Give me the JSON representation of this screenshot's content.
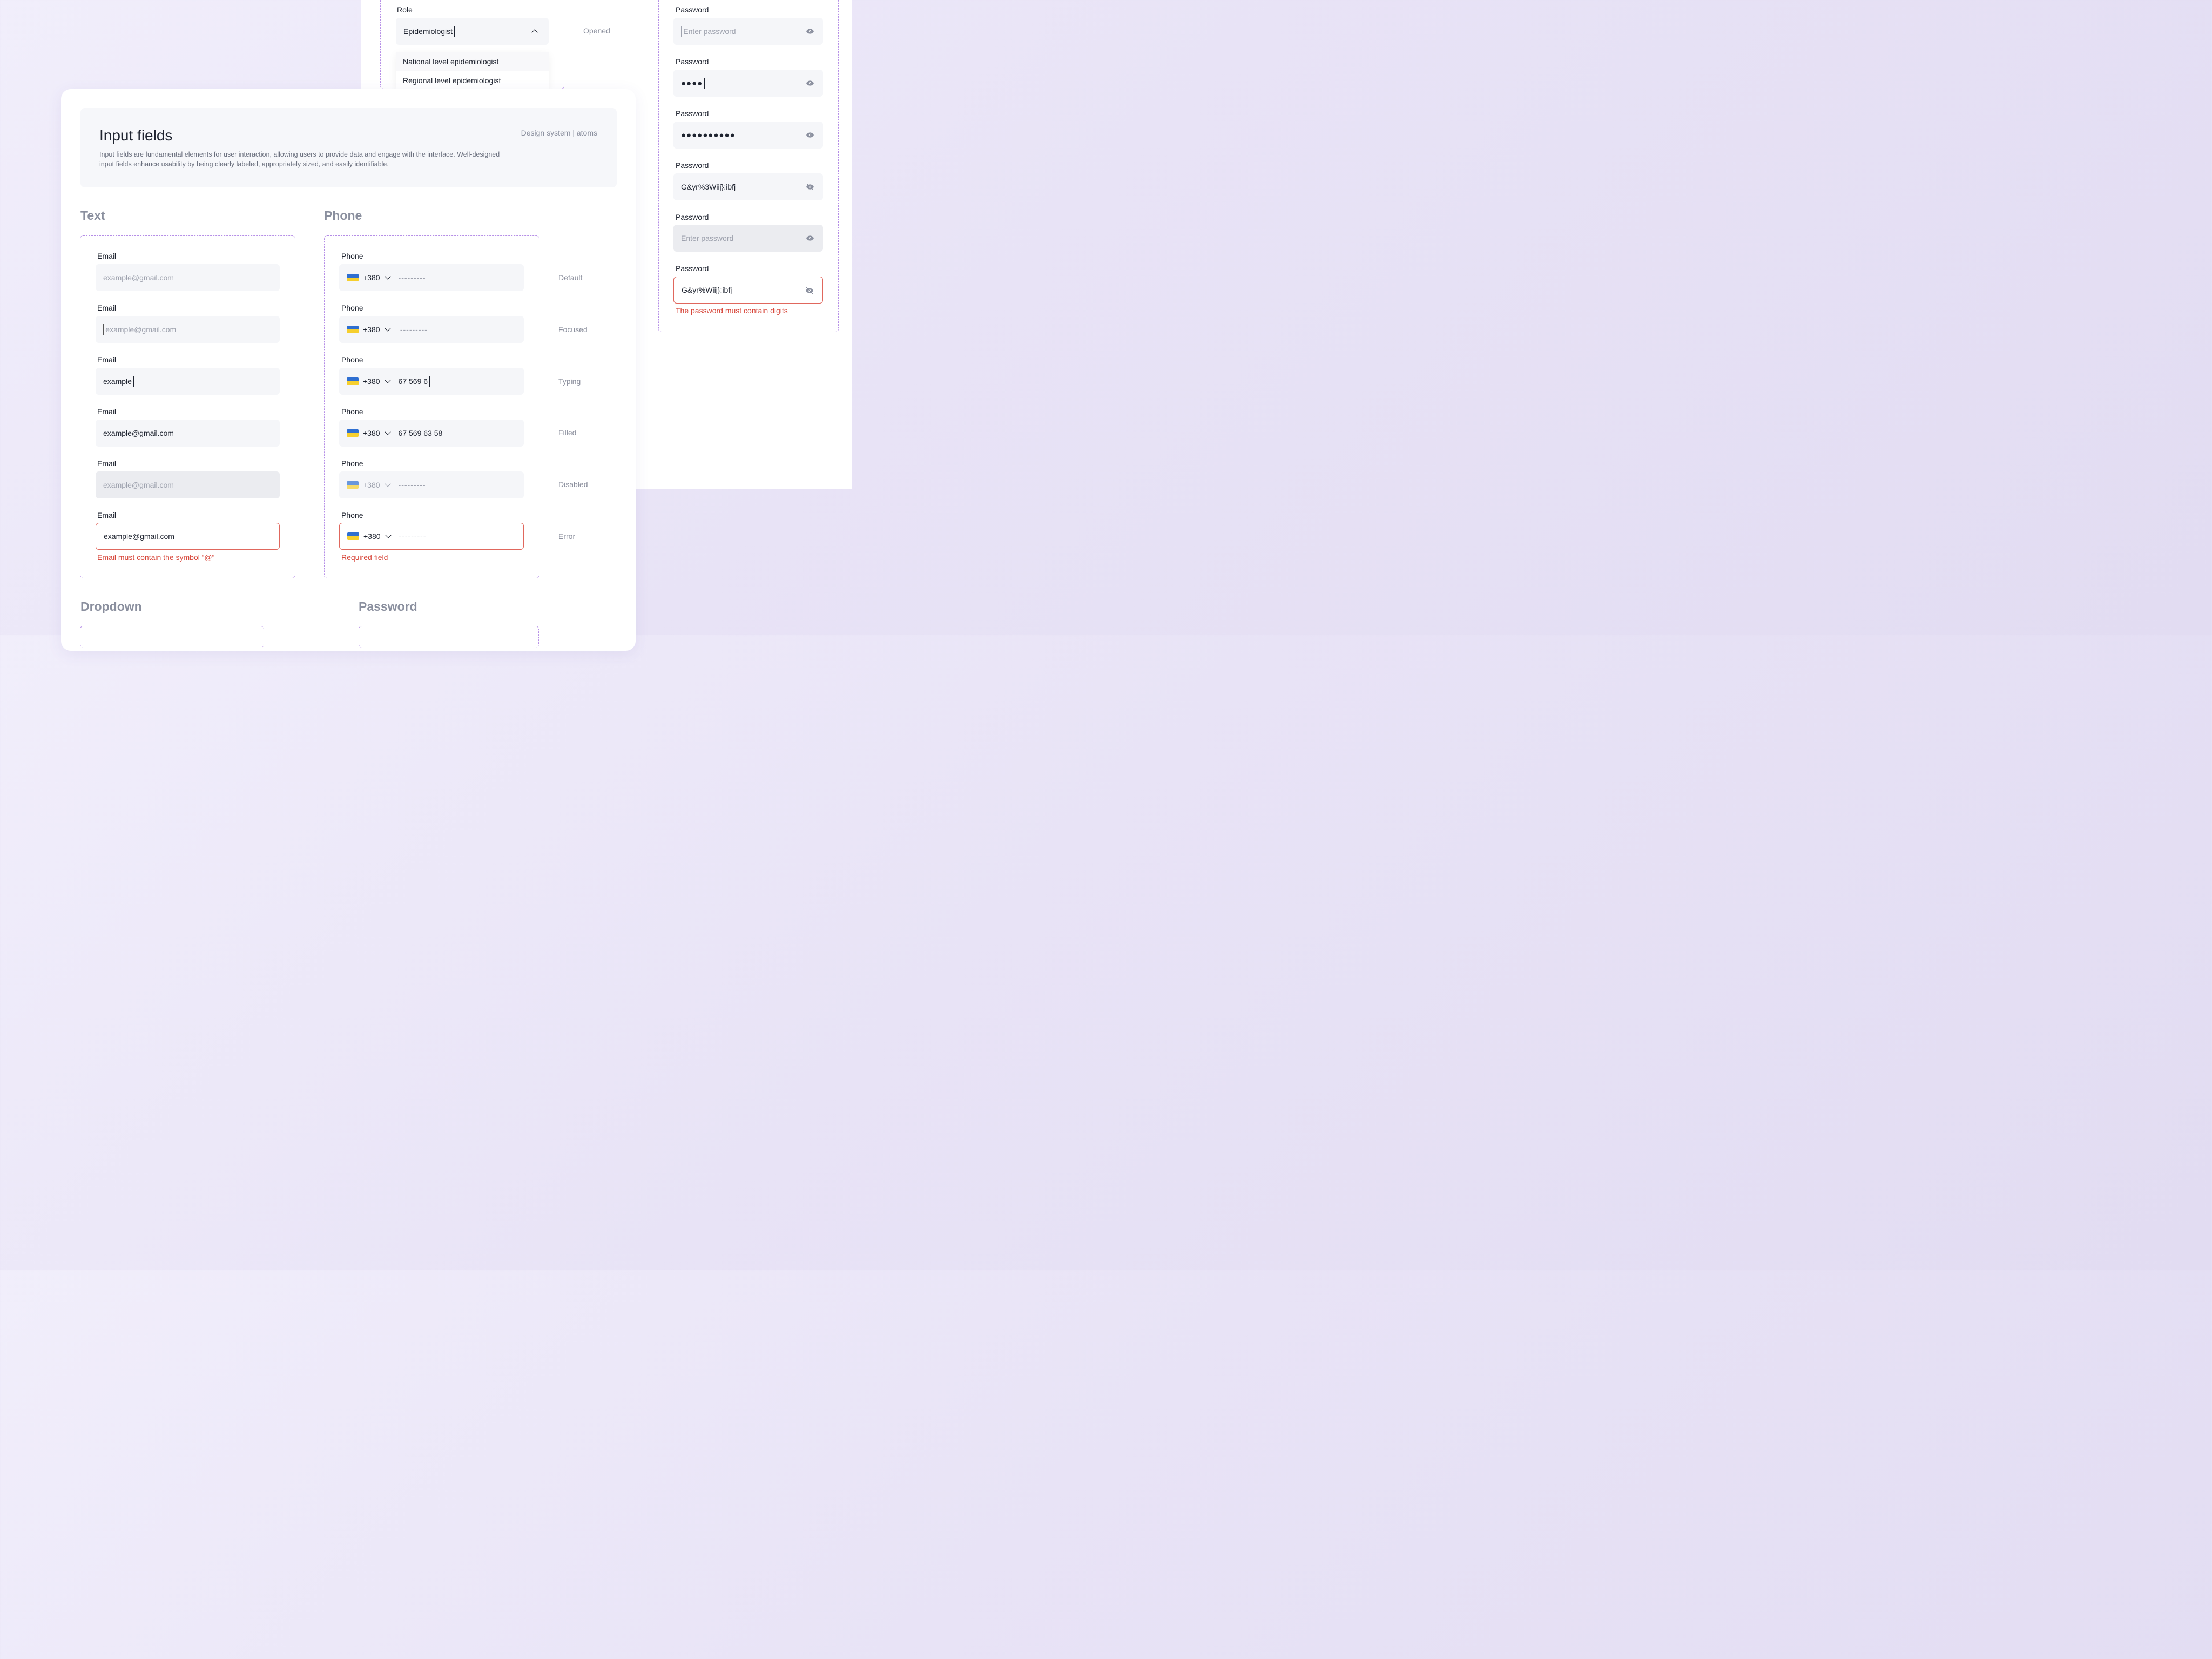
{
  "header": {
    "title": "Input fields",
    "description": "Input fields are fundamental elements for user interaction, allowing users to provide data and engage with the interface. Well-designed input fields enhance usability by being clearly labeled, appropriately sized, and easily identifiable.",
    "breadcrumb": "Design system | atoms"
  },
  "sections": {
    "text": "Text",
    "phone": "Phone",
    "dropdown": "Dropdown",
    "password": "Password"
  },
  "states": [
    "Default",
    "Focused",
    "Typing",
    "Filled",
    "Disabled",
    "Error"
  ],
  "email": {
    "label": "Email",
    "placeholder": "example@gmail.com",
    "typing": "example",
    "filled": "example@gmail.com",
    "error_message": "Email must contain the symbol “@”"
  },
  "phone": {
    "label": "Phone",
    "code": "+380",
    "mask": "---------",
    "typing": "67 569 6",
    "filled": "67 569 63 58",
    "error_message": "Required field"
  },
  "dropdown": {
    "label": "Role",
    "value": "Epidemiologist",
    "state": "Opened",
    "options": [
      "National level epidemiologist",
      "Regional level epidemiologist"
    ]
  },
  "password": {
    "label": "Password",
    "placeholder": "Enter password",
    "masked_short": "●●●●",
    "masked_long": "●●●●●●●●●●",
    "revealed": "G&yr%3Wiij}:ibfj",
    "error_value": "G&yr%Wiij}:ibfj",
    "error_message": "The password must contain digits"
  },
  "colors": {
    "dashed_border": "#b48ce6",
    "error": "#d7463a",
    "field_bg": "#f5f6f9",
    "flag_blue": "#2f6fd1",
    "flag_yellow": "#f6cf2e"
  }
}
